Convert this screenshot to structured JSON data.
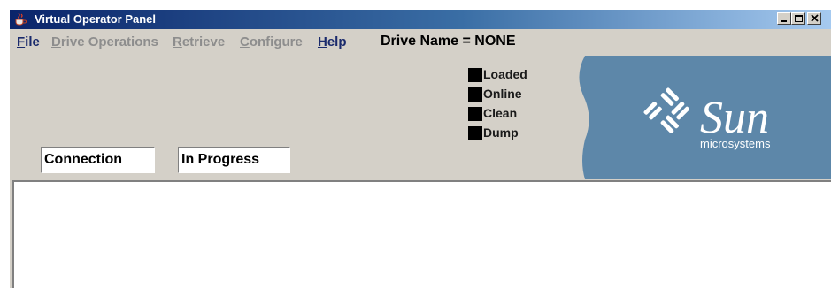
{
  "window": {
    "title": "Virtual Operator Panel"
  },
  "menu": {
    "file": {
      "mnemonic": "F",
      "rest": "ile"
    },
    "drive_operations": {
      "mnemonic": "D",
      "rest": "rive Operations"
    },
    "retrieve": {
      "mnemonic": "R",
      "rest": "etrieve"
    },
    "configure": {
      "mnemonic": "C",
      "rest": "onfigure"
    },
    "help": {
      "mnemonic": "H",
      "rest": "elp"
    }
  },
  "drive_name": "Drive Name = NONE",
  "indicators": [
    {
      "label": "Loaded"
    },
    {
      "label": "Online"
    },
    {
      "label": "Clean"
    },
    {
      "label": "Dump"
    }
  ],
  "status": {
    "connection": "Connection",
    "progress": "In Progress"
  },
  "brand": {
    "name": "Sun",
    "tagline": "microsystems",
    "panel_color": "#5d87a9"
  },
  "colors": {
    "window_bg": "#d4d0c8",
    "title_gradient_start": "#0a246a",
    "title_gradient_end": "#a6caf0",
    "menu_enabled": "#1a2a6c",
    "menu_disabled": "#8d8d8d",
    "indicator_off": "#000000"
  }
}
